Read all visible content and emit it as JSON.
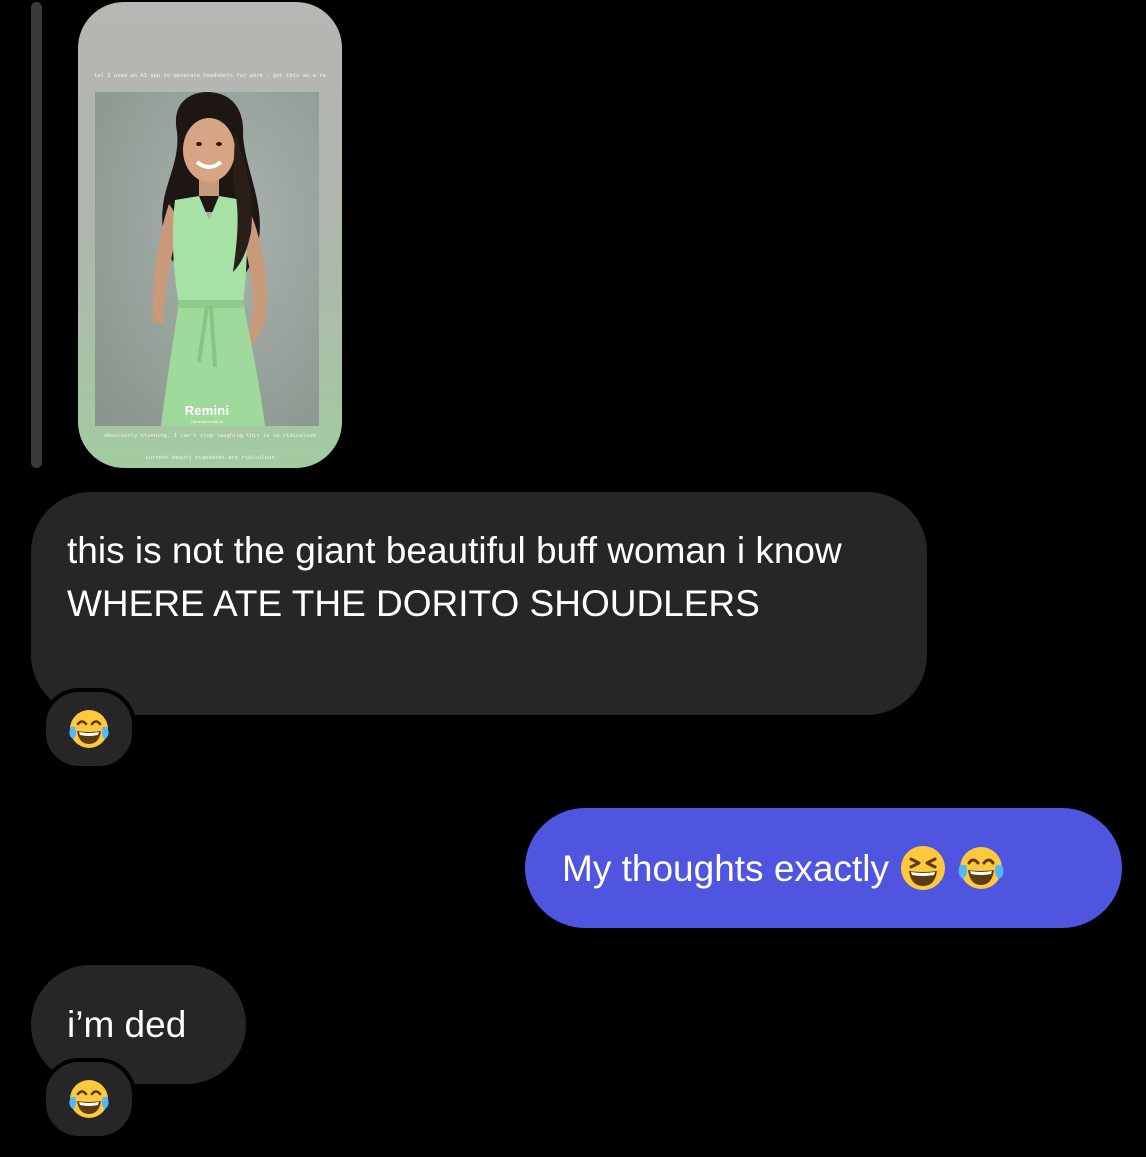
{
  "story_reply": {
    "caption_top": "lol I used an AI app to generate headshots for work - got this as a result",
    "watermark": "Remini",
    "watermark_sub": "Generated with AI",
    "caption_middle": "absolutely stunning. I can't stop laughing this is so ridiculous",
    "caption_bottom": "current beauty standards are ridiculous"
  },
  "messages": [
    {
      "direction": "received",
      "text": "this is not the giant beautiful buff woman i know WHERE ATE THE DORITO SHOUDLERS",
      "reaction": "face-with-tears-of-joy"
    },
    {
      "direction": "sent",
      "text": "My thoughts exactly",
      "emojis": [
        "grinning-squinting-face",
        "face-with-tears-of-joy"
      ]
    },
    {
      "direction": "received",
      "text": "i’m ded",
      "reaction": "face-with-tears-of-joy"
    }
  ],
  "colors": {
    "background": "#000000",
    "received_bubble": "#262628",
    "sent_bubble": "#5055e0",
    "text": "#ffffff"
  }
}
